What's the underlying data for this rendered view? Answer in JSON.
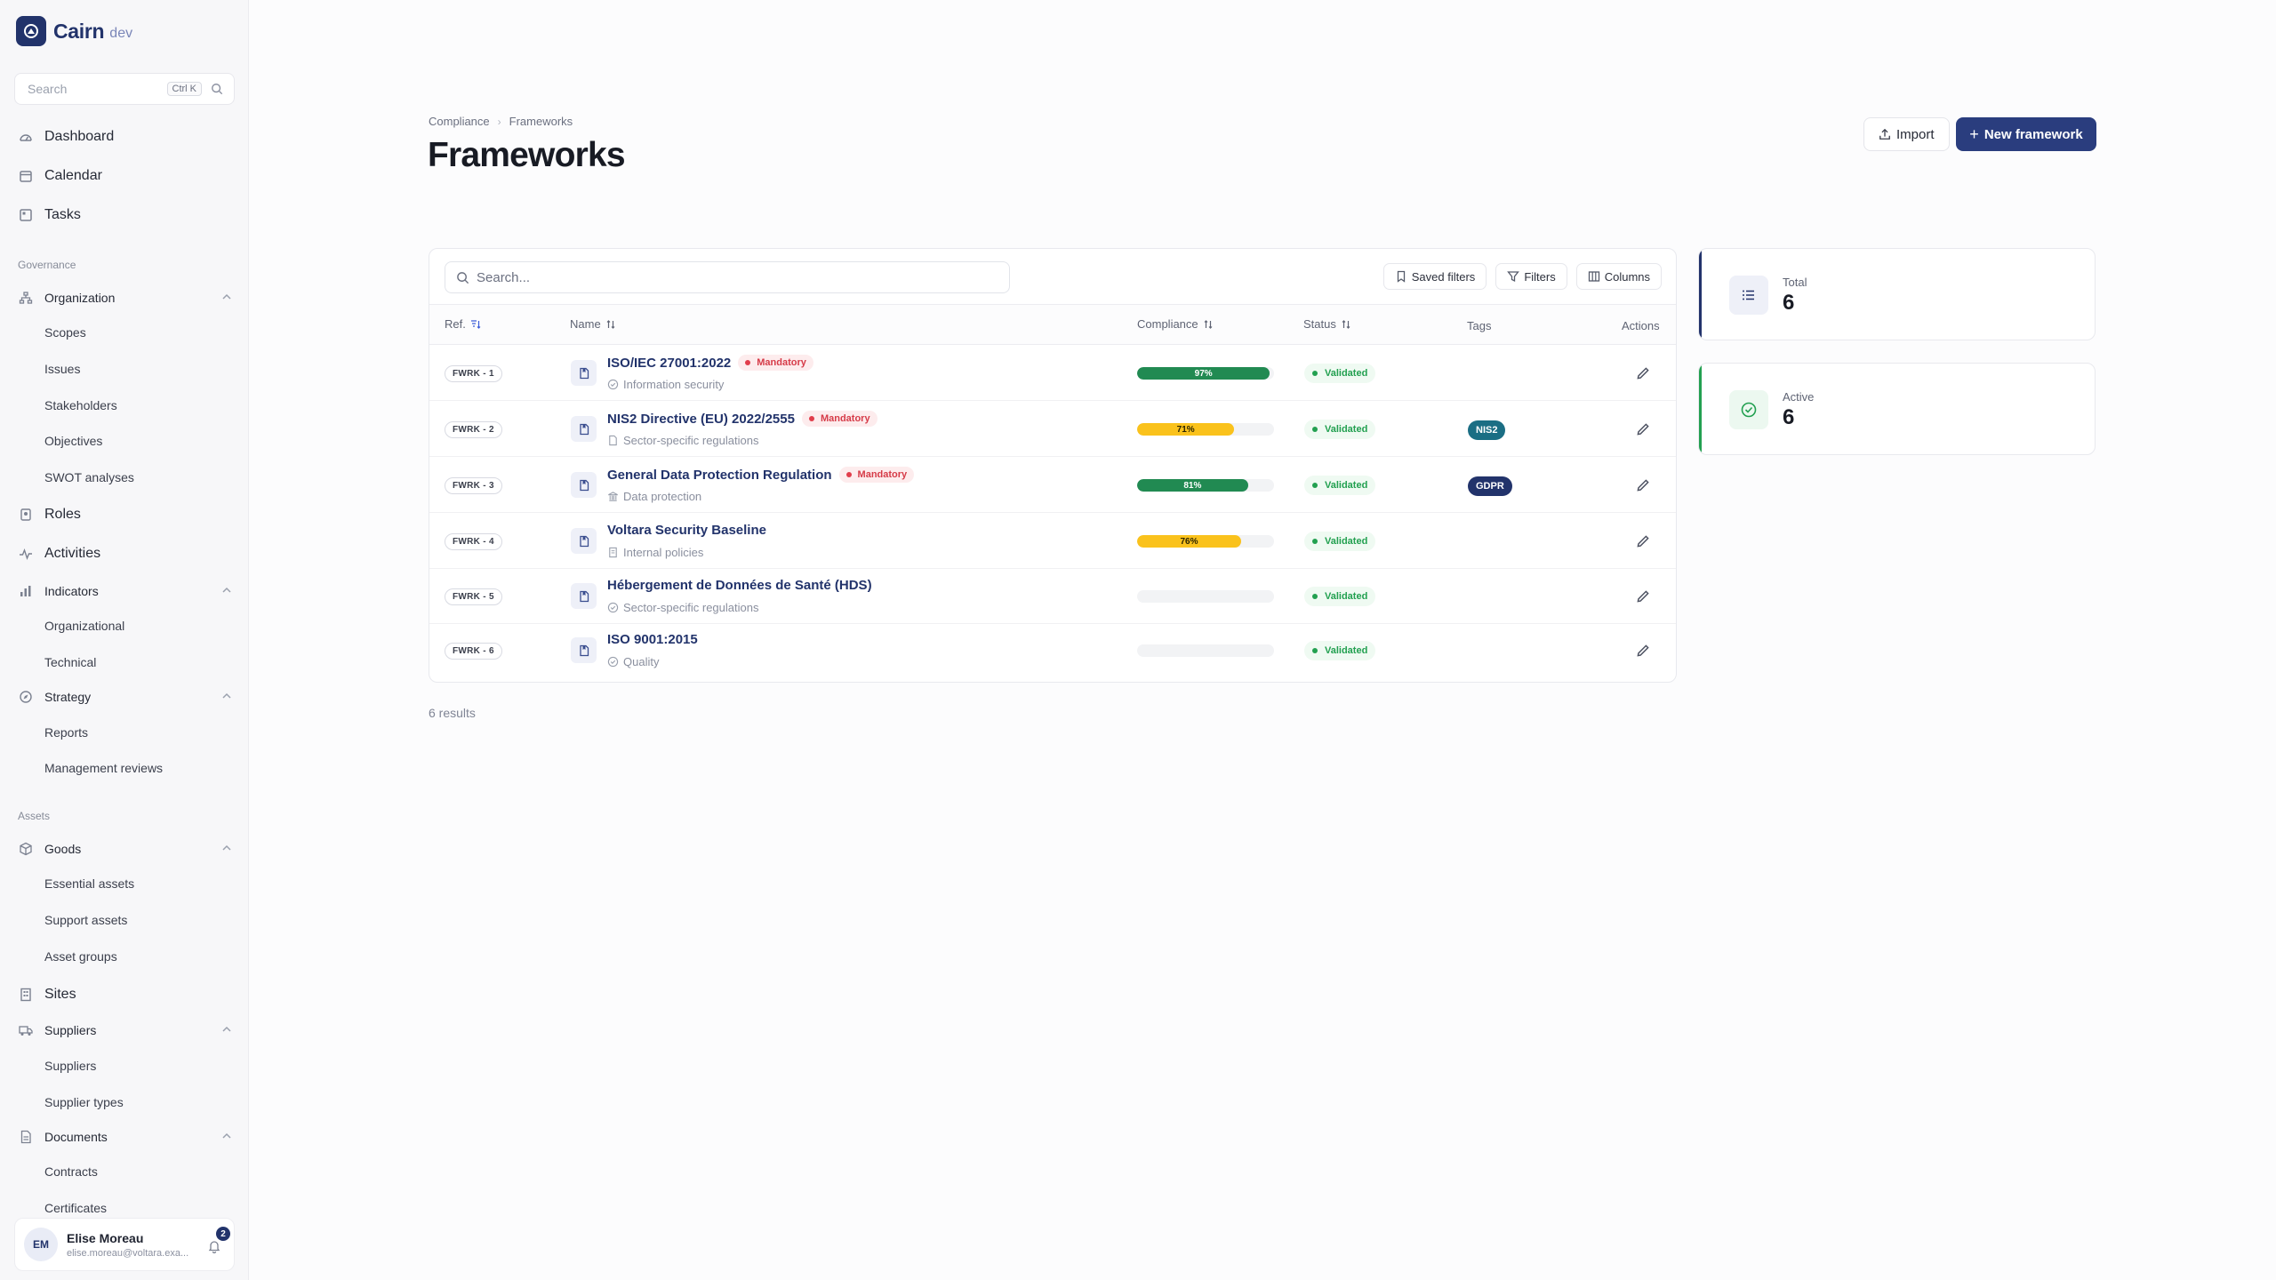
{
  "app": {
    "name": "Cairn",
    "env": "dev"
  },
  "sidebar": {
    "search_placeholder": "Search",
    "search_shortcut": "Ctrl K",
    "top_items": [
      "Dashboard",
      "Calendar",
      "Tasks"
    ],
    "governance_label": "Governance",
    "organization": {
      "label": "Organization",
      "children": [
        "Scopes",
        "Issues",
        "Stakeholders",
        "Objectives",
        "SWOT analyses"
      ]
    },
    "roles": "Roles",
    "activities": "Activities",
    "indicators": {
      "label": "Indicators",
      "children": [
        "Organizational",
        "Technical"
      ]
    },
    "strategy": {
      "label": "Strategy",
      "children": [
        "Reports",
        "Management reviews"
      ]
    },
    "assets_label": "Assets",
    "goods": {
      "label": "Goods",
      "children": [
        "Essential assets",
        "Support assets",
        "Asset groups"
      ]
    },
    "sites": "Sites",
    "suppliers": {
      "label": "Suppliers",
      "children": [
        "Suppliers",
        "Supplier types"
      ]
    },
    "documents": {
      "label": "Documents",
      "children": [
        "Contracts",
        "Certificates"
      ]
    }
  },
  "user": {
    "initials": "EM",
    "name": "Elise Moreau",
    "email": "elise.moreau@voltara.exa...",
    "notifications": "2"
  },
  "breadcrumb": [
    "Compliance",
    "Frameworks"
  ],
  "page_title": "Frameworks",
  "actions": {
    "import": "Import",
    "new": "New framework"
  },
  "table": {
    "search_placeholder": "Search...",
    "tools": [
      "Saved filters",
      "Filters",
      "Columns"
    ],
    "columns": [
      "Ref.",
      "Name",
      "Compliance",
      "Status",
      "Tags",
      "Actions"
    ],
    "rows": [
      {
        "ref": "FWRK - 1",
        "name": "ISO/IEC 27001:2022",
        "mandatory": "Mandatory",
        "category": "Information security",
        "compliance": 97,
        "compliance_label": "97%",
        "status": "Validated",
        "tag": ""
      },
      {
        "ref": "FWRK - 2",
        "name": "NIS2 Directive (EU) 2022/2555",
        "mandatory": "Mandatory",
        "category": "Sector-specific regulations",
        "compliance": 71,
        "compliance_label": "71%",
        "status": "Validated",
        "tag": "NIS2"
      },
      {
        "ref": "FWRK - 3",
        "name": "General Data Protection Regulation",
        "mandatory": "Mandatory",
        "category": "Data protection",
        "compliance": 81,
        "compliance_label": "81%",
        "status": "Validated",
        "tag": "GDPR"
      },
      {
        "ref": "FWRK - 4",
        "name": "Voltara Security Baseline",
        "mandatory": "",
        "category": "Internal policies",
        "compliance": 76,
        "compliance_label": "76%",
        "status": "Validated",
        "tag": ""
      },
      {
        "ref": "FWRK - 5",
        "name": "Hébergement de Données de Santé (HDS)",
        "mandatory": "",
        "category": "Sector-specific regulations",
        "compliance": 0,
        "compliance_label": "",
        "status": "Validated",
        "tag": ""
      },
      {
        "ref": "FWRK - 6",
        "name": "ISO 9001:2015",
        "mandatory": "",
        "category": "Quality",
        "compliance": 0,
        "compliance_label": "",
        "status": "Validated",
        "tag": ""
      }
    ],
    "results": "6 results"
  },
  "stats": [
    {
      "label": "Total",
      "value": "6"
    },
    {
      "label": "Active",
      "value": "6"
    }
  ],
  "colors": {
    "brand": "#22336b",
    "progress_green": "#218a52",
    "progress_yellow": "#fac21c",
    "tag_nis2": "#1b6e84",
    "tag_gdpr": "#22336b",
    "status_green": "#22a050",
    "mandatory_red": "#d63b48"
  }
}
